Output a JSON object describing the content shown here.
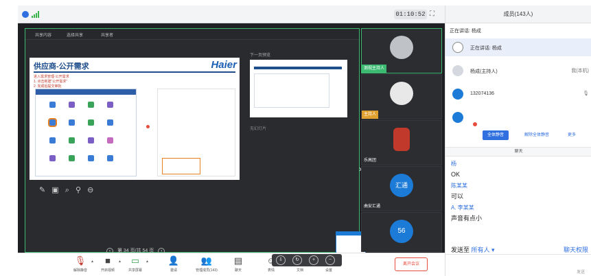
{
  "window": {
    "timer": "01:10:52"
  },
  "stage": {
    "toolbar": [
      "共享内容",
      "选择共享",
      "共享者"
    ],
    "slide": {
      "title": "供应商-公开需求",
      "brand": "Haier",
      "notes": [
        "进入需求管理-公开需求",
        "1. 点击新建“公开需求”",
        "2. 完成后提交审批"
      ]
    },
    "thumb_label": "下一页预览",
    "side_label": "无幻灯片",
    "pager": "第 34 页/共 54 页"
  },
  "videos": [
    {
      "name": "测视主持人",
      "badge": "摄像机关闭",
      "avatar_color": "#bfc3c8"
    },
    {
      "name": "主持人",
      "badge": "鹏",
      "avatar_color": "#e8e8e8"
    },
    {
      "name": "乐高团",
      "badge": "",
      "avatar_color": "#c0392b"
    },
    {
      "name": "曲安汇通",
      "badge": "汇通",
      "avatar_color": "#1d7bd8"
    },
    {
      "name": "",
      "badge": "56",
      "avatar_color": "#1d7bd8"
    }
  ],
  "toolbar": [
    {
      "label": "解除静音",
      "icon": "mic-muted-icon"
    },
    {
      "label": "开启视频",
      "icon": "camera-off-icon"
    },
    {
      "label": "共享屏幕",
      "icon": "screen-share-icon"
    },
    {
      "label": "邀请",
      "icon": "invite-icon"
    },
    {
      "label": "管理成员(143)",
      "icon": "members-icon"
    },
    {
      "label": "聊天",
      "icon": "chat-icon"
    },
    {
      "label": "表情",
      "icon": "emoji-icon"
    },
    {
      "label": "文档",
      "icon": "document-icon"
    },
    {
      "label": "设置",
      "icon": "settings-icon"
    }
  ],
  "end_button": "离开会议",
  "sidebar": {
    "title": "成员(143人)",
    "speaking": "正在讲话: 杨成",
    "participants": [
      {
        "name": "正在讲话: 杨成",
        "role": "",
        "color": "#888888"
      },
      {
        "name": "杨成(主持人)",
        "role": "我(本机)",
        "color": "#9aa4b1"
      },
      {
        "name": "132074136",
        "role": "",
        "color": "#1d7bd8"
      },
      {
        "name": "",
        "role": "",
        "color": "#e74c3c"
      }
    ],
    "buttons": {
      "mute_all": "全体静音",
      "unmute_all": "解除全体静音",
      "more": "更多"
    },
    "chat_header": "聊天",
    "messages": [
      {
        "who": "杨",
        "text": ""
      },
      {
        "who": "",
        "text": "OK"
      },
      {
        "who": "陈某某",
        "text": ""
      },
      {
        "who": "",
        "text": "可以"
      },
      {
        "who": "A. 李某某",
        "text": ""
      },
      {
        "who": "",
        "text": "声音有点小"
      }
    ],
    "send_to_label": "发送至",
    "send_to_value": "所有人",
    "permission": "聊天权限",
    "send": "发送"
  }
}
